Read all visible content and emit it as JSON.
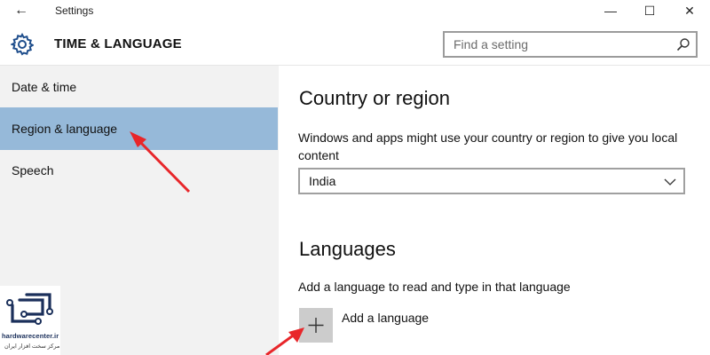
{
  "window": {
    "title": "Settings",
    "back_glyph": "←",
    "minimize_glyph": "—",
    "maximize_glyph": "☐",
    "close_glyph": "✕"
  },
  "header": {
    "icon": "gear-icon",
    "title": "TIME & LANGUAGE",
    "search_placeholder": "Find a setting",
    "search_icon": "search-icon"
  },
  "sidebar": {
    "items": [
      {
        "label": "Date & time",
        "selected": false
      },
      {
        "label": "Region & language",
        "selected": true
      },
      {
        "label": "Speech",
        "selected": false
      }
    ]
  },
  "country_section": {
    "title": "Country or region",
    "description": "Windows and apps might use your country or region to give you local content",
    "selected_country": "India"
  },
  "languages_section": {
    "title": "Languages",
    "description": "Add a language to read and type in that language",
    "add_label": "Add a language",
    "add_icon": "plus-icon"
  },
  "watermark": {
    "url": "hardwarecenter.ir",
    "tagline": "مرکز سخت افزار ایران"
  },
  "colors": {
    "selected_bg": "#96b9d9",
    "sidebar_bg": "#f2f2f2",
    "annotation_arrow": "#e8262a",
    "add_button_bg": "#cccccc"
  }
}
